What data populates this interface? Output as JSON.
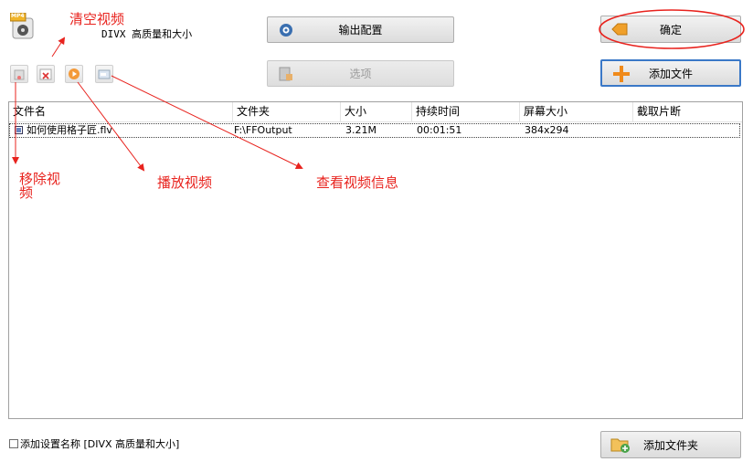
{
  "format": {
    "badge": "MP4",
    "name": "DIVX 高质量和大小"
  },
  "buttons": {
    "output_config": "输出配置",
    "options": "选项",
    "ok": "确定",
    "add_file": "添加文件",
    "add_folder": "添加文件夹"
  },
  "table": {
    "columns": [
      "文件名",
      "文件夹",
      "大小",
      "持续时间",
      "屏幕大小",
      "截取片断"
    ],
    "rows": [
      {
        "file": "如何使用格子匠.flv",
        "folder": "F:\\FFOutput",
        "size": "3.21M",
        "duration": "00:01:51",
        "screen": "384x294",
        "clip": ""
      }
    ]
  },
  "annotations": {
    "clear": "清空视频",
    "remove": "移除视频",
    "play": "播放视频",
    "info": "查看视频信息"
  },
  "footer": {
    "checkbox_label": "添加设置名称 [DIVX 高质量和大小]",
    "checked": false
  },
  "colors": {
    "annotation": "#e8231e",
    "accent_border": "#3a78c7"
  }
}
